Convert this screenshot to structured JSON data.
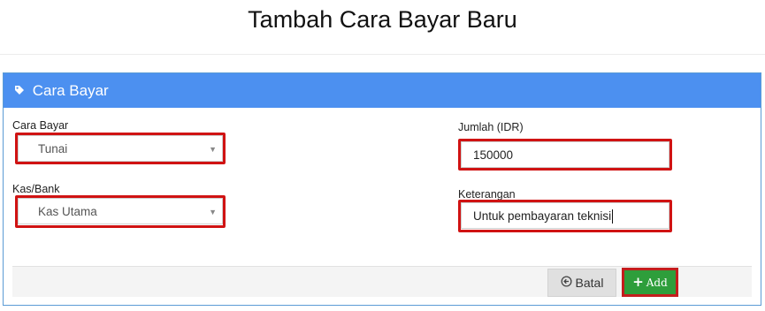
{
  "page": {
    "title": "Tambah Cara Bayar Baru"
  },
  "panel": {
    "title": "Cara Bayar",
    "icon": "tag-icon"
  },
  "form": {
    "cara_bayar": {
      "label": "Cara Bayar",
      "value": "Tunai"
    },
    "kas_bank": {
      "label": "Kas/Bank",
      "value": "Kas Utama"
    },
    "jumlah": {
      "label": "Jumlah (IDR)",
      "value": "150000"
    },
    "keterangan": {
      "label": "Keterangan",
      "value": "Untuk pembayaran teknisi"
    }
  },
  "buttons": {
    "batal": {
      "label": "Batal",
      "icon": "circle-arrow-left-icon"
    },
    "add": {
      "label": "Add",
      "icon": "plus-icon"
    }
  },
  "colors": {
    "panel_header": "#4c90f0",
    "highlight": "#d01313",
    "add_button": "#2e9e3b"
  }
}
